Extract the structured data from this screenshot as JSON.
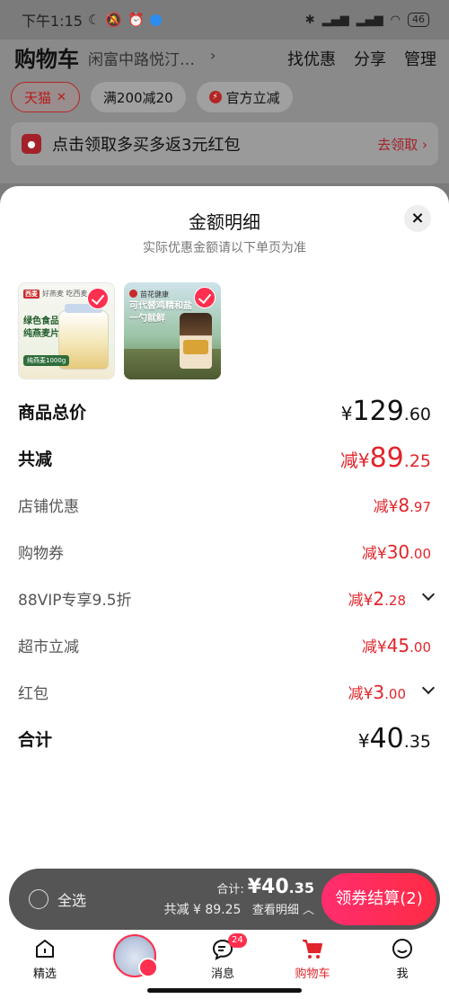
{
  "status_bar": {
    "time": "下午1:15",
    "battery": "46"
  },
  "header": {
    "title": "购物车",
    "location": "闲富中路悦汀…",
    "actions": [
      "找优惠",
      "分享",
      "管理"
    ]
  },
  "filters": [
    {
      "label": "天猫",
      "active": true
    },
    {
      "label": "满200减20",
      "active": false
    },
    {
      "label": "官方立减",
      "active": false
    }
  ],
  "promo": {
    "text": "点击领取多买多返3元红包",
    "link": "去领取 ›"
  },
  "sheet": {
    "title": "金额明细",
    "subtitle": "实际优惠金额请以下单页为准",
    "close_icon": "×",
    "products": [
      {
        "brand": "西麦",
        "tag": "好燕麦 吃西麦",
        "name_line1": "绿色食品",
        "name_line2": "纯燕麦片",
        "band": "纯燕麦1000g",
        "selected": true
      },
      {
        "brand": "苗花健康",
        "line1": "可代替鸡精和盐",
        "line2": "一勺就鲜",
        "selected": true
      }
    ],
    "rows": [
      {
        "label": "商品总价",
        "prefix": "¥",
        "int": "129",
        "dec": ".60",
        "kind": "total"
      },
      {
        "label": "共减",
        "prefix": "减¥",
        "int": "89",
        "dec": ".25",
        "kind": "major"
      },
      {
        "label": "店铺优惠",
        "prefix": "减¥",
        "int": "8",
        "dec": ".97"
      },
      {
        "label": "购物券",
        "prefix": "减¥",
        "int": "30",
        "dec": ".00"
      },
      {
        "label": "88VIP专享9.5折",
        "prefix": "减¥",
        "int": "2",
        "dec": ".28",
        "caret": true
      },
      {
        "label": "超市立减",
        "prefix": "减¥",
        "int": "45",
        "dec": ".00"
      },
      {
        "label": "红包",
        "prefix": "减¥",
        "int": "3",
        "dec": ".00",
        "caret": true
      },
      {
        "label": "合计",
        "prefix": "¥",
        "int": "40",
        "dec": ".35",
        "kind": "total"
      }
    ]
  },
  "checkout": {
    "select_all": "全选",
    "sum_label": "合计:",
    "sum_int": "¥40",
    "sum_dec": ".35",
    "saved": "共减 ¥ 89.25",
    "detail": "查看明细 ︿",
    "button": "领券结算(2)"
  },
  "tabs": [
    {
      "label": "精选"
    },
    {
      "label": "消息",
      "badge": "24"
    },
    {
      "label": "购物车"
    },
    {
      "label": "我"
    }
  ]
}
